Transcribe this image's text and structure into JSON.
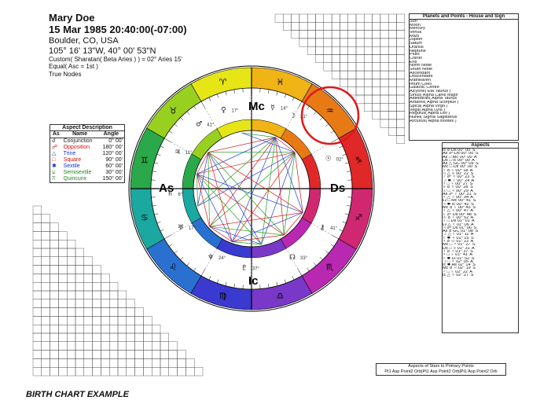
{
  "header": {
    "name": "Mary Doe",
    "datetime": "15 Mar 1985 20:40:00(-07:00)",
    "location": "Boulder, CO, USA",
    "coords": "105° 16' 13\"W, 40° 00' 53\"N",
    "ayanamsa": "Custom( Sharatan( Beta Aries ) ) = 02° Aries 15'",
    "houses": "Equal( Asc = 1st )",
    "nodes": "True Nodes"
  },
  "caption": "BIRTH CHART EXAMPLE",
  "aspect_description": {
    "title": "Aspect Description",
    "headers": [
      "As",
      "Name",
      "Angle"
    ],
    "rows": [
      {
        "glyph": "☌",
        "name": "Conjunction",
        "angle": "0° 00'",
        "color": "#222222"
      },
      {
        "glyph": "☍",
        "name": "Opposition",
        "angle": "180° 00'",
        "color": "#d01010"
      },
      {
        "glyph": "△",
        "name": "Trine",
        "angle": "120° 00'",
        "color": "#1030d0"
      },
      {
        "glyph": "□",
        "name": "Square",
        "angle": "90° 00'",
        "color": "#d01010"
      },
      {
        "glyph": "✱",
        "name": "Sextile",
        "angle": "60° 00'",
        "color": "#1030d0"
      },
      {
        "glyph": "⚺",
        "name": "Semisextile",
        "angle": "30° 00'",
        "color": "#1a8a1a"
      },
      {
        "glyph": "⚻",
        "name": "Quincunx",
        "angle": "150° 00'",
        "color": "#1a8a1a"
      }
    ]
  },
  "planets_table": {
    "title": "Planets and Points - House and Sign",
    "rows": [
      "Sun",
      "Moon",
      "Mercury",
      "Venus",
      "Mars",
      "Jupiter",
      "Saturn",
      "Uranus",
      "Neptune",
      "Pluto",
      "Chiron",
      "Eris",
      "North Node",
      "South Node",
      "Ascendant",
      "Descendant",
      "Midheaven",
      "Imum Coeli",
      "Galactic Centre",
      "Alcyone( Eta Taurus )",
      "Sirius( Alpha Canis Major )",
      "Aldebaran( Alpha Taurus )",
      "Antares( Alpha Scorpius )",
      "Spica( Alpha Virgo )",
      "Vega( Alpha Lyra )",
      "Regulus( Alpha Leo )",
      "Nunki( Sigma Sagittarius )",
      "Arcturus( Alpha Bootes )"
    ]
  },
  "aspects_table": {
    "title": "Aspects",
    "rows": [
      "Ic ☌ Ds 00° 00' S",
      "As ☍ Ds 00° 00' S",
      "As □ Mc 00° 00' A",
      "Ds □ Ic 00° 00' A",
      "As △ GC 00° 09' S",
      "Mc □ Ds 00° 00' S",
      "♀ ☌ ♄ 00° 18' A",
      "♃ △ ♅ 00° 22' S",
      "♂ ☍ ♆ 00° 23' S",
      "☽ ✱ ♀ 00° 24' A",
      "♆ □ ♀ 00° 27' S",
      "♅ ☌ ♆ 00° 28' S",
      "☉ □ ♃ 00° 29' A",
      "As ☍ ♇ 00° 31' S",
      "♀ △ ♂ 00° 34' A",
      "☊ □ Mc 00° 41' S",
      "♃ ✱ Ic 00° 42' S",
      "Mc ☌ ♄ 00° 43' S",
      "☿ △ ♃ 00° 47' A",
      "♄ ☍ Ds 00° 48' S",
      "☉ ☌ ♀ 00° 52' A",
      "♀ □ Ds 01° 01' A",
      "☊ △ ☿ 01° 06' A",
      "♃ ☍ Ds 01° 06' S",
      "As ☌ GC 01° 08' S",
      "☽ △ ♇ 01° 11' A",
      "♄ ✱ ♃ 01° 15' S",
      "☿ ☌ ☉ 01° 22' A",
      "Mc □ ♂ 01° 27' S",
      "Ds □ ♅ 01° 31' A",
      "♀ ☌ ♂ 01° 37' S",
      "☿ □ ♄ 01° 41' A",
      "♇ ✱ ☊ 01° 52' S",
      "☽ □ ♆ 02° 05' A",
      "Ic ✱ As 02° 14' S",
      "Mc ☌ ♃ 02° 19' S",
      "♂ □ ♄ 02° 22' A",
      "Ic △ ♆ 02° 27' S"
    ]
  },
  "stars_table": {
    "title": "Aspects of Stars to Primary Points",
    "headers": "Pt1 Asp Point2 Orb|Pt1 Asp Point2 Orb|Pt1 Asp Point2 Orb"
  },
  "wheel": {
    "ring_colors": [
      "#e6e616",
      "#98d020",
      "#2aa84a",
      "#1aa8a0",
      "#2a70d0",
      "#3a3ad0",
      "#7a38c8",
      "#b828b0",
      "#d02870",
      "#e02828",
      "#e87a16",
      "#f0b416"
    ],
    "signs": [
      "♈",
      "♉",
      "♊",
      "♋",
      "♌",
      "♍",
      "♎",
      "♏",
      "♐",
      "♑",
      "♒",
      "♓"
    ],
    "angle_labels": {
      "mc": "Mc",
      "ic": "Ic",
      "asc": "As",
      "dsc": "Ds"
    },
    "planet_labels": [
      {
        "g": "☉",
        "deg": "02°"
      },
      {
        "g": "☽",
        "deg": "21°"
      },
      {
        "g": "☿",
        "deg": "14°"
      },
      {
        "g": "♀",
        "deg": "17°"
      },
      {
        "g": "♂",
        "deg": "41°"
      },
      {
        "g": "♃",
        "deg": "11°"
      },
      {
        "g": "♄",
        "deg": "6°"
      },
      {
        "g": "♅",
        "deg": "17°"
      },
      {
        "g": "♆",
        "deg": "24°"
      },
      {
        "g": "♇",
        "deg": "37°"
      },
      {
        "g": "☊",
        "deg": "33°"
      },
      {
        "g": "⚷",
        "deg": "41°"
      }
    ],
    "highlight_color": "#e01818",
    "aspect_colors": {
      "red": "#d81818",
      "blue": "#2040d0",
      "green": "#20a020"
    }
  }
}
